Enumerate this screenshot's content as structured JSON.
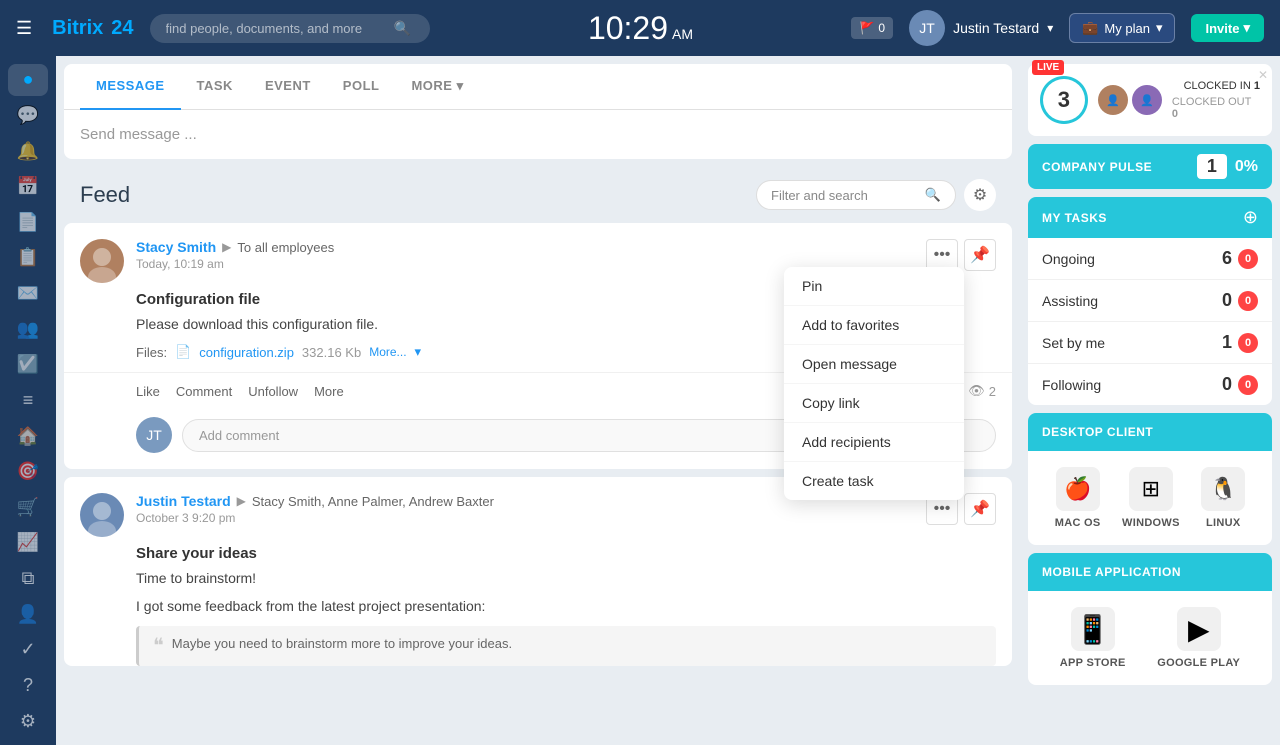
{
  "topnav": {
    "logo_prefix": "Bitrix",
    "logo_suffix": "24",
    "search_placeholder": "find people, documents, and more",
    "time": "10:29",
    "time_ampm": "AM",
    "flag_label": "0",
    "user_name": "Justin Testard",
    "myplan_label": "My plan",
    "invite_label": "Invite"
  },
  "feed": {
    "title": "Feed",
    "filter_placeholder": "Filter and search"
  },
  "composer": {
    "tabs": [
      "MESSAGE",
      "TASK",
      "EVENT",
      "POLL",
      "MORE +"
    ],
    "placeholder": "Send message ..."
  },
  "context_menu": {
    "items": [
      "Pin",
      "Add to favorites",
      "Open message",
      "Copy link",
      "Add recipients",
      "Create task"
    ]
  },
  "post1": {
    "author": "Stacy Smith",
    "to": "To all employees",
    "time": "Today, 10:19 am",
    "title": "Configuration file",
    "body": "Please download this configuration file.",
    "files_label": "Files:",
    "file_name": "configuration.zip",
    "file_size": "332.16 Kb",
    "more_label": "More...",
    "actions": [
      "Like",
      "Comment",
      "Unfollow",
      "More"
    ],
    "views": "2",
    "comment_placeholder": "Add comment"
  },
  "post2": {
    "author": "Justin Testard",
    "to": "Stacy Smith, Anne Palmer, Andrew Baxter",
    "time": "October 3 9:20 pm",
    "title": "Share your ideas",
    "body": "Time to brainstorm!",
    "body2": "I got some feedback from the latest project presentation:",
    "quote": "Maybe you need to brainstorm more to improve your ideas."
  },
  "right_sidebar": {
    "live_badge": "LIVE",
    "live_count": "3",
    "clocked_in_label": "CLOCKED IN",
    "clocked_in_count": "1",
    "clocked_out_label": "CLOCKED OUT",
    "clocked_out_count": "0",
    "pulse_label": "COMPANY PULSE",
    "pulse_count": "1",
    "pulse_pct": "0%",
    "tasks_header": "MY TASKS",
    "tasks": [
      {
        "label": "Ongoing",
        "count": "6",
        "red": "0"
      },
      {
        "label": "Assisting",
        "count": "0",
        "red": "0"
      },
      {
        "label": "Set by me",
        "count": "1",
        "red": "0"
      },
      {
        "label": "Following",
        "count": "0",
        "red": "0"
      }
    ],
    "desktop_header": "DESKTOP CLIENT",
    "desktop_apps": [
      {
        "label": "MAC OS",
        "icon": "🍎"
      },
      {
        "label": "WINDOWS",
        "icon": "⊞"
      },
      {
        "label": "LINUX",
        "icon": "🐧"
      }
    ],
    "mobile_header": "MOBILE APPLICATION",
    "mobile_apps": [
      {
        "label": "APP STORE",
        "icon": "📱"
      },
      {
        "label": "GOOGLE PLAY",
        "icon": "▶"
      }
    ]
  }
}
